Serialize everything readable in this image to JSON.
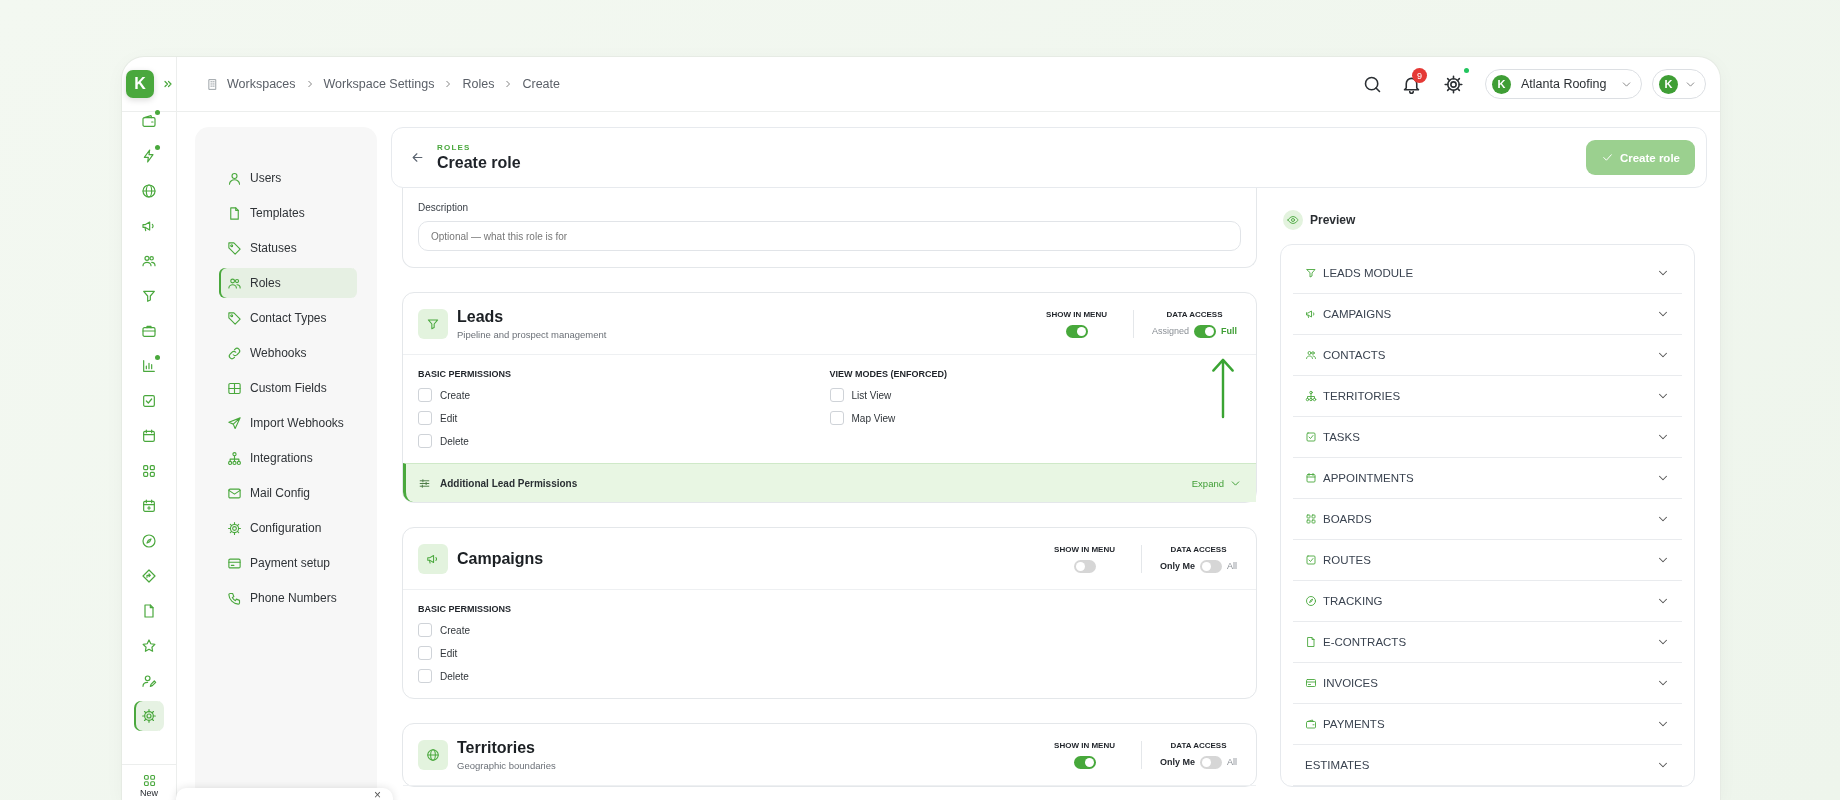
{
  "rail": {
    "logo_letter": "K",
    "items": [
      {
        "selected": false,
        "dot": true
      },
      {
        "selected": false,
        "dot": true
      },
      {
        "selected": false,
        "dot": false
      },
      {
        "selected": false,
        "dot": false
      },
      {
        "selected": false,
        "dot": false
      },
      {
        "selected": false,
        "dot": false
      },
      {
        "selected": false,
        "dot": false
      },
      {
        "selected": false,
        "dot": true
      },
      {
        "selected": false,
        "dot": false
      },
      {
        "selected": false,
        "dot": false
      },
      {
        "selected": false,
        "dot": false
      },
      {
        "selected": false,
        "dot": false
      },
      {
        "selected": false,
        "dot": false
      },
      {
        "selected": false,
        "dot": false
      },
      {
        "selected": false,
        "dot": false
      },
      {
        "selected": false,
        "dot": false
      },
      {
        "selected": false,
        "dot": false
      },
      {
        "selected": true,
        "dot": false
      }
    ],
    "new_label": "New"
  },
  "topbar": {
    "breadcrumb": [
      "Workspaces",
      "Workspace Settings",
      "Roles",
      "Create"
    ],
    "notification_count": "9",
    "settings_dot": true,
    "workspace": "Atlanta Roofing",
    "workspace_logo": "K",
    "account_logo": "K"
  },
  "settings_nav": {
    "items": [
      {
        "label": "Users",
        "selected": false
      },
      {
        "label": "Templates",
        "selected": false
      },
      {
        "label": "Statuses",
        "selected": false
      },
      {
        "label": "Roles",
        "selected": true
      },
      {
        "label": "Contact Types",
        "selected": false
      },
      {
        "label": "Webhooks",
        "selected": false
      },
      {
        "label": "Custom Fields",
        "selected": false
      },
      {
        "label": "Import Webhooks",
        "selected": false
      },
      {
        "label": "Integrations",
        "selected": false
      },
      {
        "label": "Mail Config",
        "selected": false
      },
      {
        "label": "Configuration",
        "selected": false
      },
      {
        "label": "Payment setup",
        "selected": false
      },
      {
        "label": "Phone Numbers",
        "selected": false
      }
    ]
  },
  "header": {
    "eyebrow": "ROLES",
    "title": "Create role",
    "create_button": {
      "label": "Create role",
      "disabled": true
    }
  },
  "description": {
    "label": "Description",
    "placeholder": "Optional — what this role is for"
  },
  "modules": [
    {
      "title": "Leads",
      "subtitle": "Pipeline and prospect management",
      "show_in_menu": {
        "label": "SHOW IN MENU",
        "on": true
      },
      "data_access": {
        "label": "DATA ACCESS",
        "off_label": "Assigned",
        "on_label": "Full",
        "on": true
      },
      "permission_groups": [
        {
          "title": "BASIC PERMISSIONS",
          "options": [
            {
              "label": "Create",
              "checked": false
            },
            {
              "label": "Edit",
              "checked": false
            },
            {
              "label": "Delete",
              "checked": false
            }
          ]
        },
        {
          "title": "VIEW MODES (ENFORCED)",
          "options": [
            {
              "label": "List View",
              "checked": false
            },
            {
              "label": "Map View",
              "checked": false
            }
          ]
        }
      ],
      "additional": {
        "label": "Additional Lead Permissions",
        "action": "Expand"
      }
    },
    {
      "title": "Campaigns",
      "show_in_menu": {
        "label": "SHOW IN MENU",
        "on": false
      },
      "data_access": {
        "label": "DATA ACCESS",
        "off_label": "Only Me",
        "on_label": "All",
        "on": false
      },
      "permission_groups": [
        {
          "title": "BASIC PERMISSIONS",
          "options": [
            {
              "label": "Create",
              "checked": false
            },
            {
              "label": "Edit",
              "checked": false
            },
            {
              "label": "Delete",
              "checked": false
            }
          ]
        }
      ]
    },
    {
      "title": "Territories",
      "subtitle": "Geographic boundaries",
      "show_in_menu": {
        "label": "SHOW IN MENU",
        "on": true
      },
      "data_access": {
        "label": "DATA ACCESS",
        "off_label": "Only Me",
        "on_label": "All",
        "on": false
      }
    }
  ],
  "preview": {
    "title": "Preview",
    "items": [
      {
        "label": "LEADS MODULE"
      },
      {
        "label": "CAMPAIGNS"
      },
      {
        "label": "CONTACTS"
      },
      {
        "label": "TERRITORIES"
      },
      {
        "label": "TASKS"
      },
      {
        "label": "APPOINTMENTS"
      },
      {
        "label": "BOARDS"
      },
      {
        "label": "ROUTES"
      },
      {
        "label": "TRACKING"
      },
      {
        "label": "E-CONTRACTS"
      },
      {
        "label": "INVOICES"
      },
      {
        "label": "PAYMENTS"
      },
      {
        "label": "ESTIMATES"
      }
    ]
  },
  "floating_panel": {
    "close": "×"
  }
}
